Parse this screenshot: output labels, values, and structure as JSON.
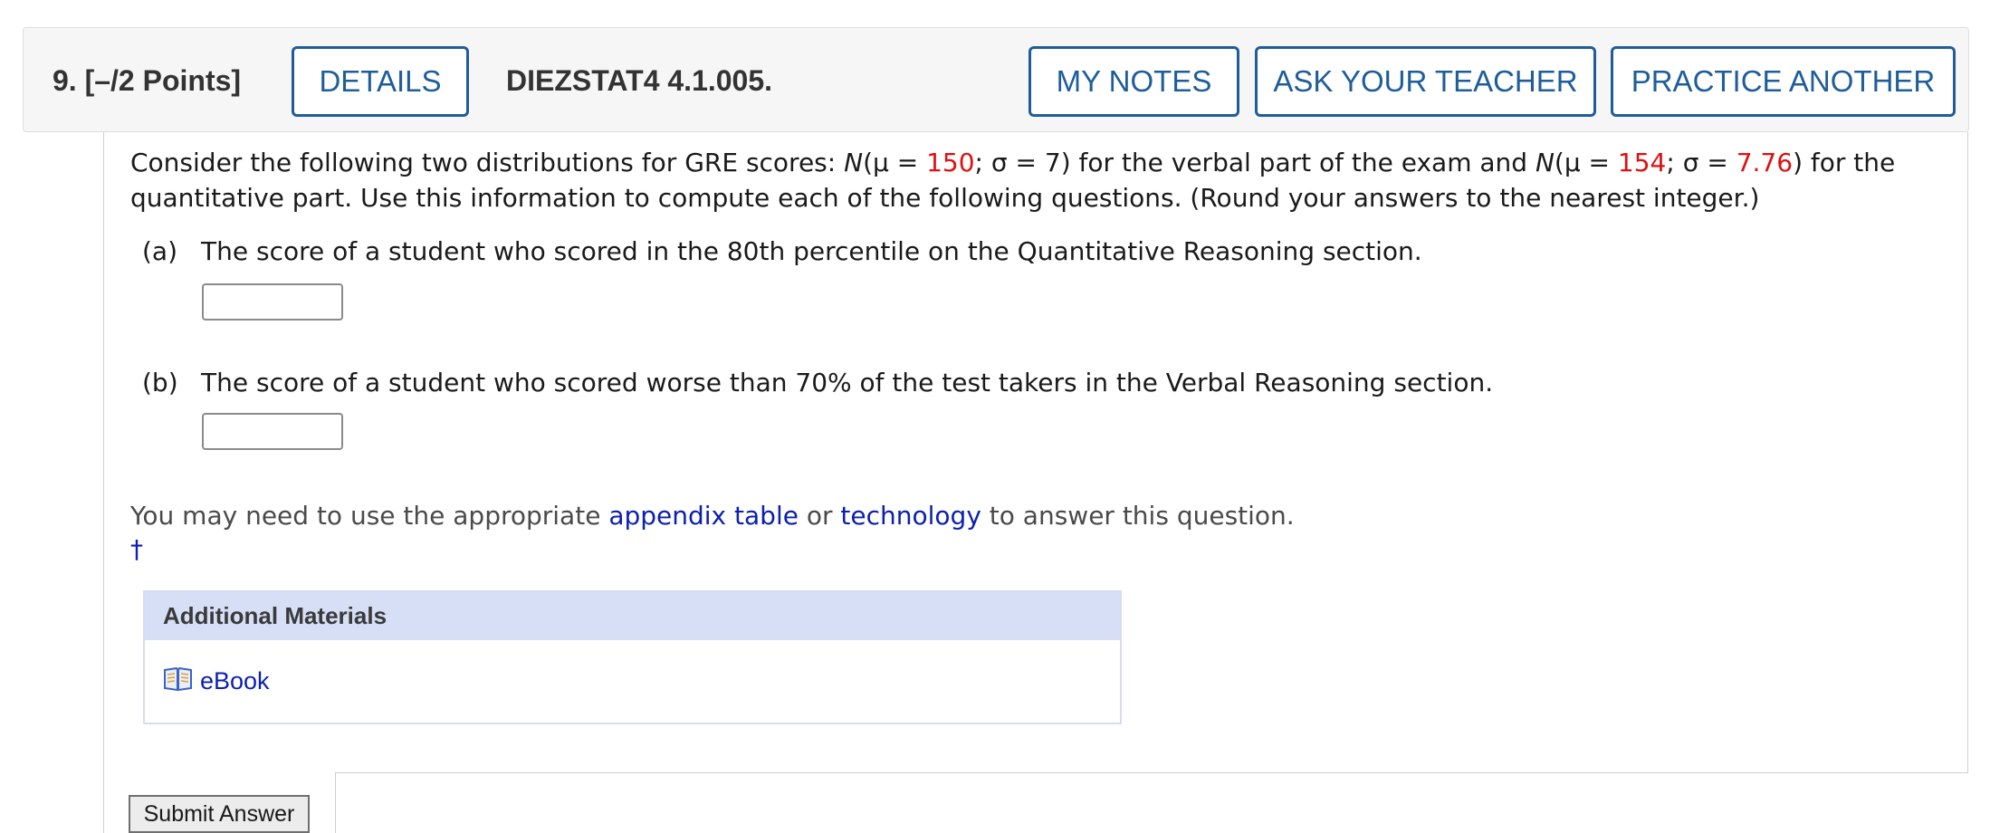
{
  "header": {
    "question_label": "9. [–/2 Points]",
    "details_label": "DETAILS",
    "problem_code": "DIEZSTAT4 4.1.005.",
    "my_notes_label": "MY NOTES",
    "ask_teacher_label": "ASK YOUR TEACHER",
    "practice_another_label": "PRACTICE ANOTHER",
    "button_color": "#1f5d99"
  },
  "question": {
    "intro_1": "Consider the following two distributions for GRE scores: ",
    "N": "N",
    "open_mu": "(μ = ",
    "verbal_mean": "150",
    "sigma_sep": "; σ = ",
    "verbal_sd": "7",
    "intro_2": ") for the verbal part of the exam and ",
    "quant_mean": "154",
    "quant_sd": "7.76",
    "intro_3": ") for the quantitative part. Use this information to compute each of the following questions. (Round your answers to the nearest integer.)",
    "highlight_color": "#e01010"
  },
  "parts": [
    {
      "label": "(a)",
      "text": "The score of a student who scored in the 80th percentile on the Quantitative Reasoning section.",
      "answer_value": ""
    },
    {
      "label": "(b)",
      "text": "The score of a student who scored worse than 70% of the test takers in the Verbal Reasoning section.",
      "answer_value": ""
    }
  ],
  "hint": {
    "before": "You may need to use the appropriate ",
    "link1": "appendix table",
    "middle": " or ",
    "link2": "technology",
    "after": " to answer this question.",
    "dagger": "†",
    "link_color": "#0c1fb0"
  },
  "materials": {
    "title": "Additional Materials",
    "items": [
      {
        "label": "eBook",
        "icon": "book-icon"
      }
    ]
  },
  "submit_label": "Submit Answer"
}
